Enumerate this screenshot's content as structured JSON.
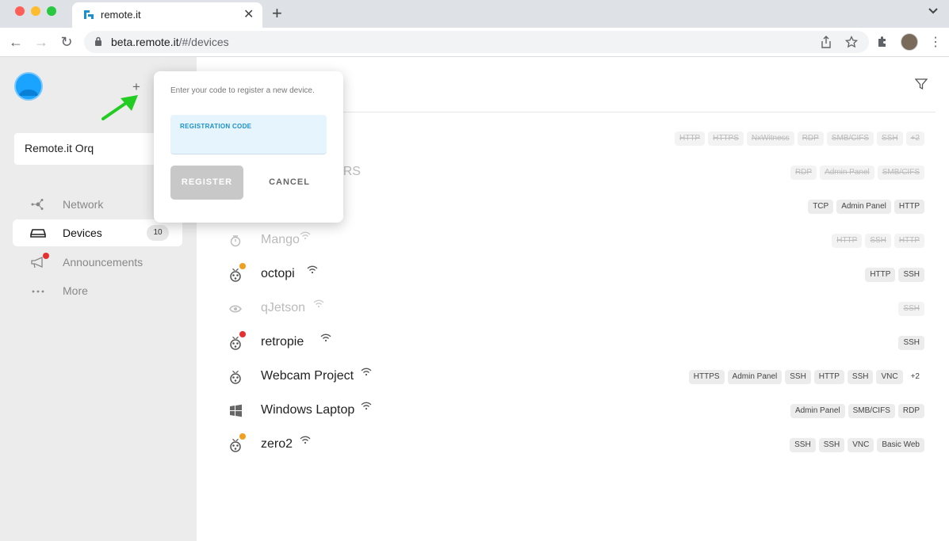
{
  "browser": {
    "tab_title": "remote.it",
    "url_host": "beta.remote.it",
    "url_path": "/#/devices"
  },
  "sidebar": {
    "org_name": "Remote.it Orq",
    "add_label": "+",
    "nav": [
      {
        "label": "Network",
        "icon": "network-icon"
      },
      {
        "label": "Devices",
        "icon": "devices-icon",
        "count": "10"
      },
      {
        "label": "Announcements",
        "icon": "megaphone-icon"
      },
      {
        "label": "More",
        "icon": "more-icon"
      }
    ]
  },
  "modal": {
    "prompt": "Enter your code to register a new device.",
    "field_label": "REGISTRATION CODE",
    "register_label": "REGISTER",
    "cancel_label": "CANCEL"
  },
  "devices": [
    {
      "name": "",
      "icon": "hidden",
      "tags": [
        "HTTP",
        "HTTPS",
        "NxWitness",
        "RDP",
        "SMB/CIFS",
        "SSH",
        "+2"
      ],
      "offline": true
    },
    {
      "name": "RTERS",
      "icon": "hidden",
      "tags": [
        "RDP",
        "Admin Panel",
        "SMB/CIFS"
      ],
      "offline": true
    },
    {
      "name": "",
      "icon": "hidden",
      "tags": [
        "TCP",
        "Admin Panel",
        "HTTP"
      ],
      "offline": false
    },
    {
      "name": "Mango",
      "icon": "generic-icon",
      "tags": [
        "HTTP",
        "SSH",
        "HTTP"
      ],
      "offline": true
    },
    {
      "name": "octopi",
      "icon": "raspberry-pi-icon",
      "tags": [
        "HTTP",
        "SSH"
      ],
      "offline": false,
      "status": "#f0a020"
    },
    {
      "name": "qJetson",
      "icon": "nvidia-icon",
      "tags": [
        "SSH"
      ],
      "offline": true
    },
    {
      "name": "retropie",
      "icon": "raspberry-pi-icon",
      "tags": [
        "SSH"
      ],
      "offline": false,
      "status": "#e53030"
    },
    {
      "name": "Webcam Project",
      "icon": "raspberry-pi-icon",
      "tags": [
        "HTTPS",
        "Admin Panel",
        "SSH",
        "HTTP",
        "SSH",
        "VNC",
        "+2"
      ],
      "offline": false
    },
    {
      "name": "Windows Laptop",
      "icon": "windows-icon",
      "tags": [
        "Admin Panel",
        "SMB/CIFS",
        "RDP"
      ],
      "offline": false
    },
    {
      "name": "zero2",
      "icon": "raspberry-pi-icon",
      "tags": [
        "SSH",
        "SSH",
        "VNC",
        "Basic Web"
      ],
      "offline": false,
      "status": "#f0a020"
    }
  ],
  "colors": {
    "accent": "#1a90d0",
    "arrow": "#22cc22"
  }
}
